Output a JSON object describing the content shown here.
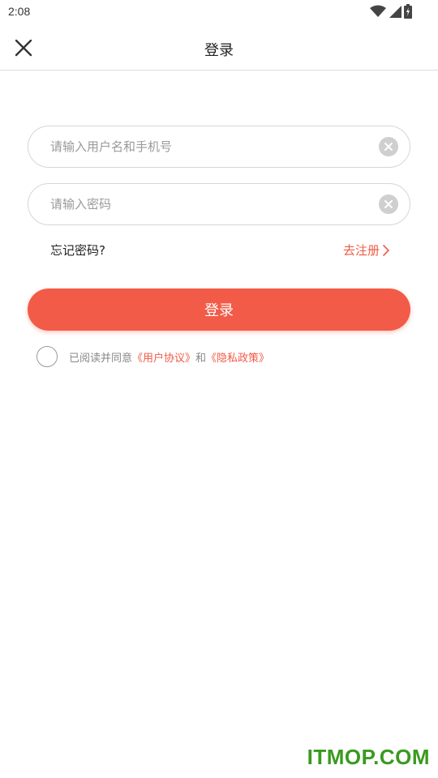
{
  "status_bar": {
    "time": "2:08"
  },
  "header": {
    "title": "登录"
  },
  "form": {
    "username_placeholder": "请输入用户名和手机号",
    "password_placeholder": "请输入密码"
  },
  "links": {
    "forgot_password": "忘记密码?",
    "register": "去注册"
  },
  "login_button": {
    "label": "登录"
  },
  "agreement": {
    "prefix": "已阅读并同意",
    "user_agreement": "《用户协议》",
    "conjunction": "和",
    "privacy_policy": "《隐私政策》"
  },
  "watermark": "ITMOP.COM",
  "colors": {
    "accent": "#f25b47",
    "link": "#f05a45",
    "watermark": "#3a9a1e"
  },
  "icons": [
    "wifi-icon",
    "signal-icon",
    "battery-icon",
    "close-icon",
    "clear-icon",
    "chevron-right-icon"
  ]
}
